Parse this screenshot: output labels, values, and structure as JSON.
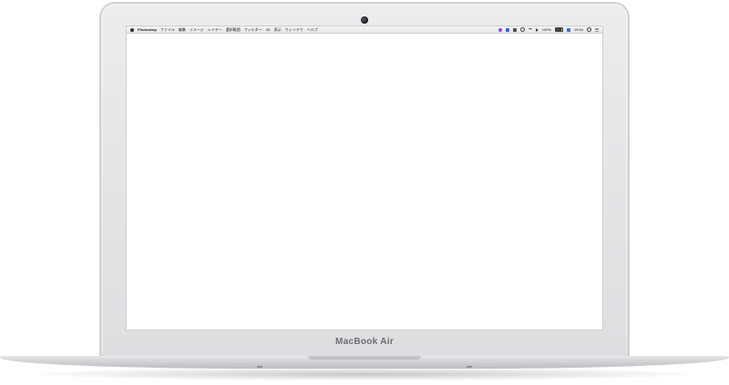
{
  "device": {
    "brand_label": "MacBook Air"
  },
  "menubar": {
    "app_name": "Photoshop",
    "items": [
      {
        "label": "ファイル"
      },
      {
        "label": "編集"
      },
      {
        "label": "イメージ"
      },
      {
        "label": "レイヤー"
      },
      {
        "label": "選択範囲"
      },
      {
        "label": "フィルター"
      },
      {
        "label": "3D"
      },
      {
        "label": "表示"
      },
      {
        "label": "ウィンドウ"
      },
      {
        "label": "ヘルプ"
      }
    ],
    "battery_text": "100%",
    "clock_text": "19:54",
    "status_icons": [
      "purple-app-icon",
      "blue-app-icon",
      "display-icon",
      "circle-icon",
      "wifi-icon",
      "speaker-icon",
      "battery-icon",
      "input-method-icon",
      "search-icon",
      "notification-list-icon"
    ]
  },
  "colors": {
    "menubar_bg": "#eeeef0",
    "screen_bg": "#ffffff",
    "bezel": "#e4e4e6"
  }
}
